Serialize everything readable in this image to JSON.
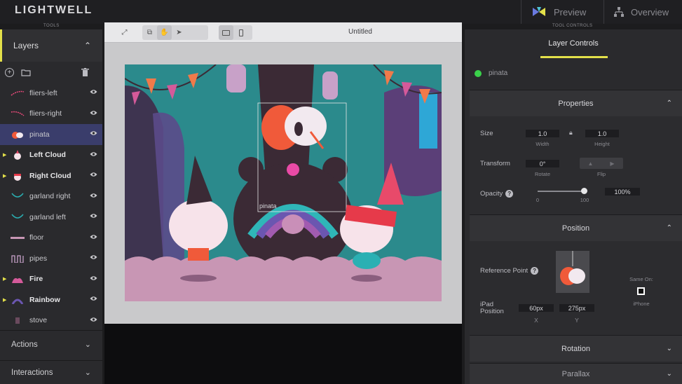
{
  "app": {
    "logo": "LIGHTWELL",
    "preview_label": "Preview",
    "overview_label": "Overview",
    "tools_label": "TOOLS",
    "tool_controls_label": "TOOL CONTROLS"
  },
  "layers_panel": {
    "title": "Layers",
    "items": [
      {
        "label": "fliers-left",
        "bold": false,
        "expandable": false,
        "selected": false
      },
      {
        "label": "fliers-right",
        "bold": false,
        "expandable": false,
        "selected": false
      },
      {
        "label": "pinata",
        "bold": false,
        "expandable": false,
        "selected": true
      },
      {
        "label": "Left Cloud",
        "bold": true,
        "expandable": true,
        "selected": false
      },
      {
        "label": "Right Cloud",
        "bold": true,
        "expandable": true,
        "selected": false
      },
      {
        "label": "garland right",
        "bold": false,
        "expandable": false,
        "selected": false
      },
      {
        "label": "garland left",
        "bold": false,
        "expandable": false,
        "selected": false
      },
      {
        "label": "floor",
        "bold": false,
        "expandable": false,
        "selected": false
      },
      {
        "label": "pipes",
        "bold": false,
        "expandable": false,
        "selected": false
      },
      {
        "label": "Fire",
        "bold": true,
        "expandable": true,
        "selected": false
      },
      {
        "label": "Rainbow",
        "bold": true,
        "expandable": true,
        "selected": false
      },
      {
        "label": "stove",
        "bold": false,
        "expandable": false,
        "selected": false
      }
    ],
    "actions_label": "Actions",
    "interactions_label": "Interactions"
  },
  "canvas": {
    "document_title": "Untitled",
    "selection_label": "pinata"
  },
  "layer_controls": {
    "tab_label": "Layer Controls",
    "layer_name": "pinata",
    "properties": {
      "title": "Properties",
      "size_label": "Size",
      "width_value": "1.0",
      "height_value": "1.0",
      "width_caption": "Width",
      "height_caption": "Height",
      "transform_label": "Transform",
      "rotate_value": "0°",
      "rotate_caption": "Rotate",
      "flip_caption": "Flip",
      "opacity_label": "Opacity",
      "opacity_min": "0",
      "opacity_max": "100",
      "opacity_value": "100%",
      "opacity_fraction": 1.0
    },
    "position": {
      "title": "Position",
      "reference_point_label": "Reference Point",
      "same_on_label": "Same On:",
      "iphone_label": "iPhone",
      "ipad_position_label_1": "iPad",
      "ipad_position_label_2": "Position",
      "x_value": "60px",
      "y_value": "275px",
      "x_caption": "X",
      "y_caption": "Y"
    },
    "rotation_title": "Rotation",
    "parallax_title": "Parallax"
  },
  "colors": {
    "accent": "#e3e04a",
    "selected_row": "#3a3d6b",
    "status_dot": "#3ad14a"
  }
}
